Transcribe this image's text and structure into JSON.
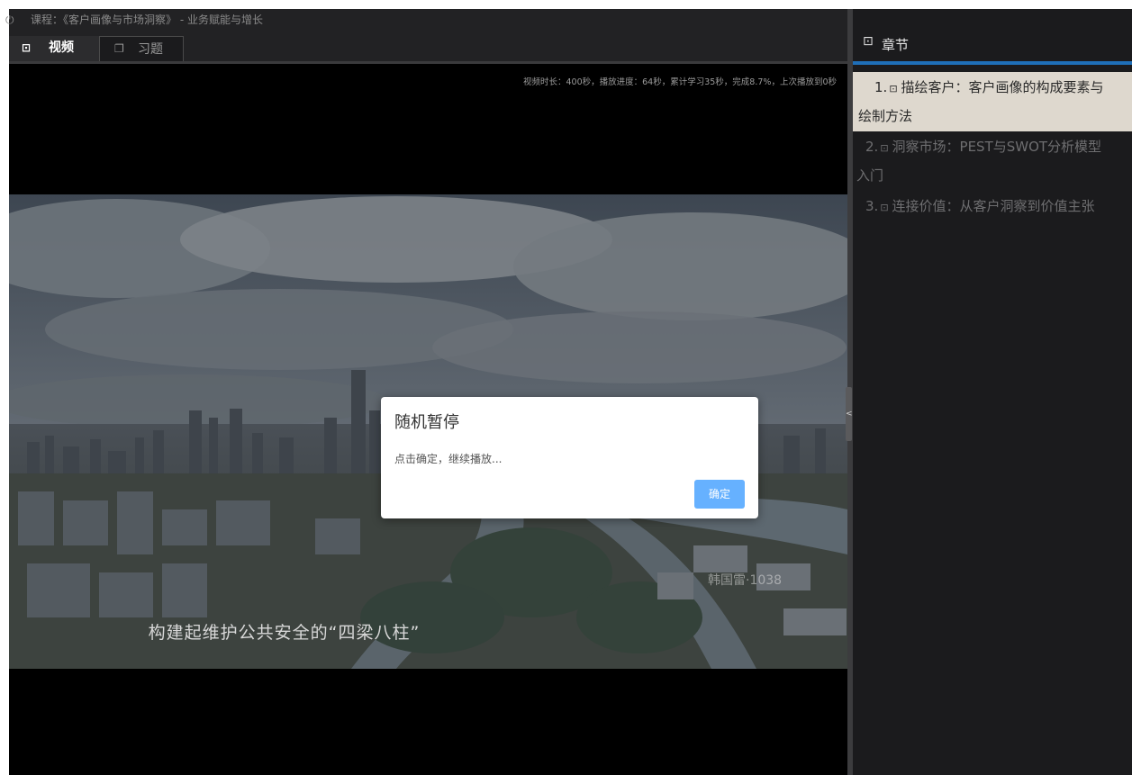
{
  "header": {
    "course_icon": "power-icon",
    "course_title": "课程：《客户画像与市场洞察》 - 业务赋能与增长"
  },
  "tabs": [
    {
      "label": "视频",
      "icon": "video-icon",
      "active": true
    },
    {
      "label": "习题",
      "icon": "document-icon",
      "active": false
    }
  ],
  "player": {
    "progress_note": "视频时长：400秒，播放进度：64秒，累计学习35秒，完成8.7%，上次播放到0秒",
    "subtitle": "构建起维护公共安全的“四梁八柱”",
    "watermark": "韩国雷·1038"
  },
  "modal": {
    "title": "随机暂停",
    "message": "点击确定，继续播放...",
    "confirm_label": "确定"
  },
  "splitter": {
    "toggle_glyph": "<"
  },
  "sidebar": {
    "title": "章节",
    "icon": "chapter-icon",
    "accent_color": "#1f6fb8",
    "chapters": [
      {
        "number": "1.",
        "line1": "描绘客户：客户画像的构成要素与",
        "line2": "绘制方法",
        "active": true
      },
      {
        "number": "2.",
        "line1": "洞察市场：PEST与SWOT分析模型",
        "line2": "入门",
        "active": false
      },
      {
        "number": "3.",
        "line1": "连接价值：从客户洞察到价值主张",
        "line2": "",
        "active": false
      }
    ]
  }
}
